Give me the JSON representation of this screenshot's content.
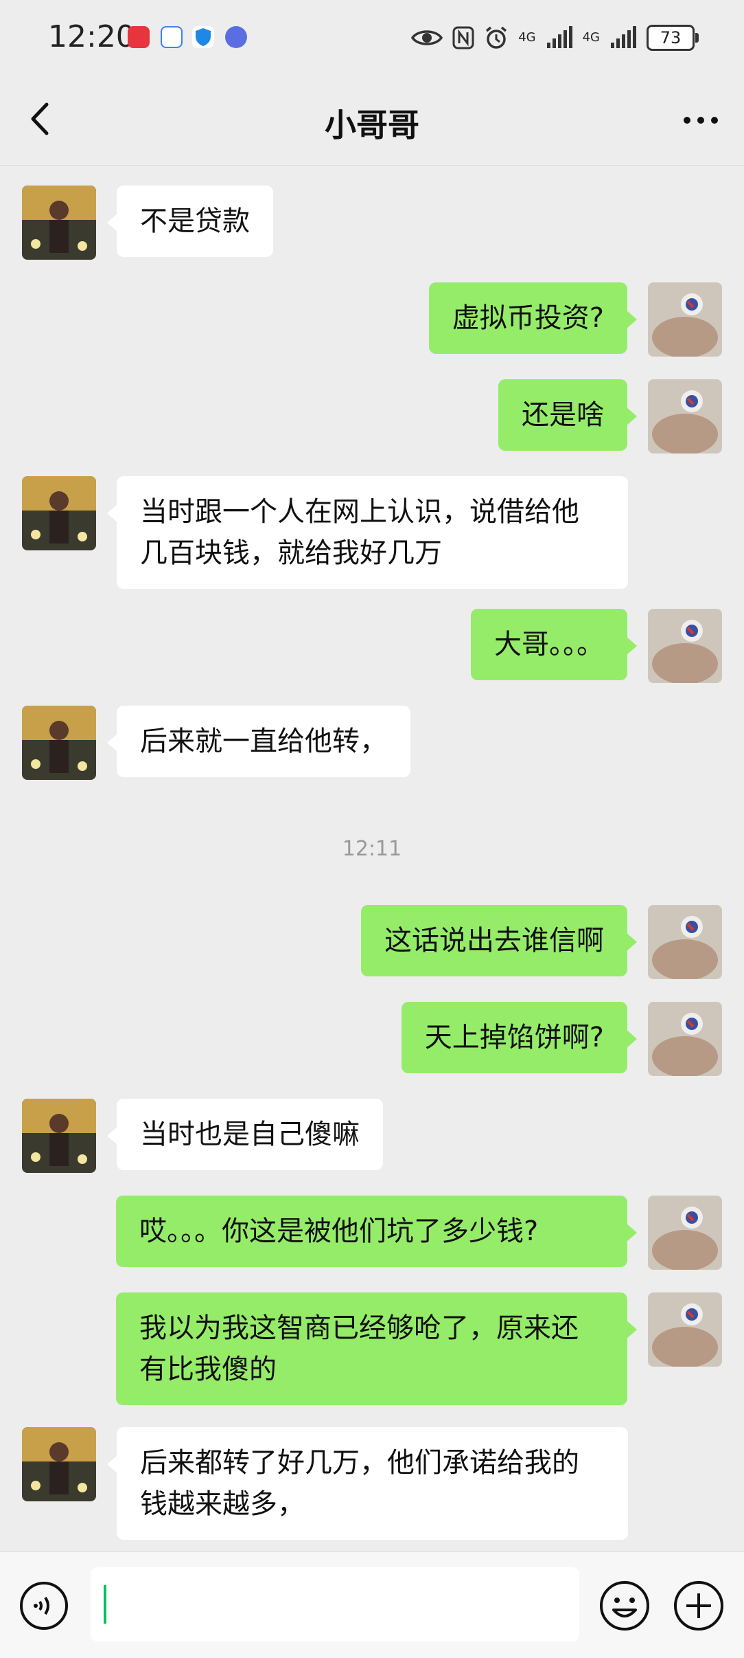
{
  "status_bar": {
    "time": "12:20",
    "network_1": "4G",
    "network_2": "4G",
    "battery": "73",
    "icons": [
      "huawei-store-icon",
      "chat-app-icon",
      "shield-app-icon",
      "music-app-icon",
      "eye-icon",
      "nfc-icon",
      "alarm-icon",
      "signal-icon",
      "signal-icon"
    ]
  },
  "header": {
    "title": "小哥哥",
    "back_icon": "chevron-left-icon",
    "more_icon": "more-dots-icon"
  },
  "messages": [
    {
      "side": "left",
      "text": "不是贷款"
    },
    {
      "side": "right",
      "text": "虚拟币投资?"
    },
    {
      "side": "right",
      "text": "还是啥"
    },
    {
      "side": "left",
      "text": "当时跟一个人在网上认识，说借给他几百块钱，就给我好几万"
    },
    {
      "side": "right",
      "text": "大哥。。。"
    },
    {
      "side": "left",
      "text": "后来就一直给他转，"
    },
    {
      "type": "time",
      "text": "12:11"
    },
    {
      "side": "right",
      "text": "这话说出去谁信啊"
    },
    {
      "side": "right",
      "text": "天上掉馅饼啊?"
    },
    {
      "side": "left",
      "text": "当时也是自己傻嘛"
    },
    {
      "side": "right",
      "text": "哎。。。你这是被他们坑了多少钱?"
    },
    {
      "side": "right",
      "text": "我以为我这智商已经够呛了，原来还有比我傻的"
    },
    {
      "side": "left",
      "text": "后来都转了好几万，他们承诺给我的钱越来越多，"
    }
  ],
  "input_bar": {
    "value": "",
    "voice_icon": "voice-icon",
    "emoji_icon": "emoji-icon",
    "plus_icon": "plus-icon"
  },
  "colors": {
    "background": "#ededed",
    "sent_bubble": "#95ec69",
    "received_bubble": "#ffffff",
    "caret": "#07c160"
  }
}
